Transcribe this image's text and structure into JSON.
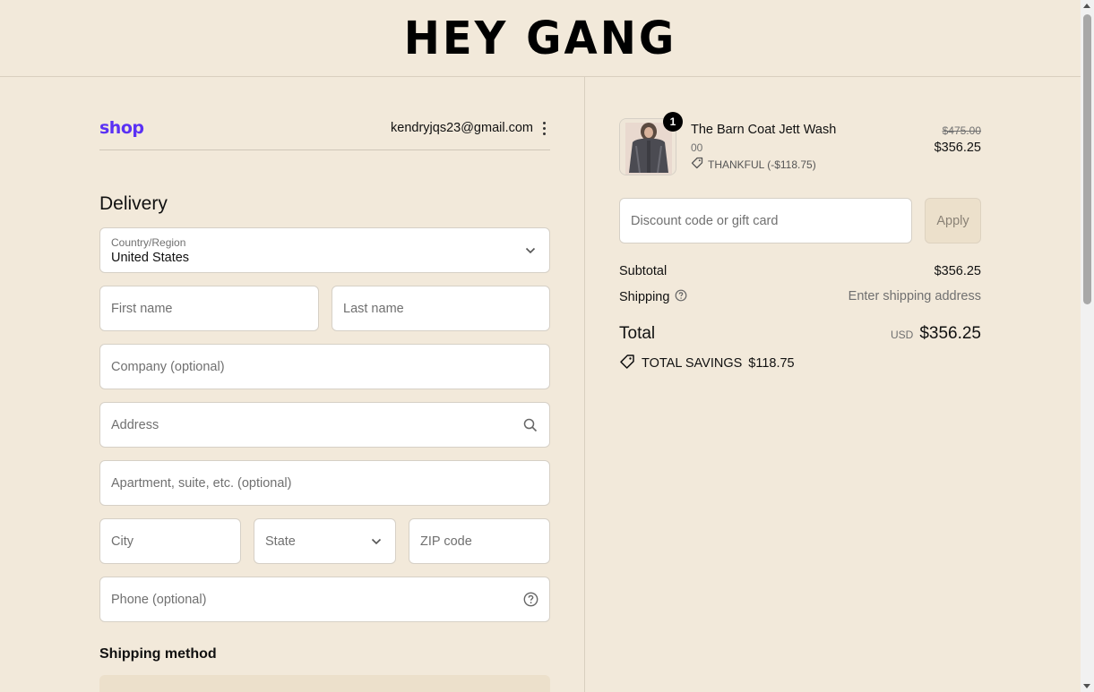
{
  "brand": {
    "logo_text": "HEY GANG"
  },
  "account": {
    "shop_logo": "shop",
    "email": "kendryjqs23@gmail.com",
    "menu_icon": "kebab-menu-icon"
  },
  "delivery": {
    "heading": "Delivery",
    "country": {
      "label": "Country/Region",
      "value": "United States"
    },
    "first_name": {
      "placeholder": "First name"
    },
    "last_name": {
      "placeholder": "Last name"
    },
    "company": {
      "placeholder": "Company (optional)"
    },
    "address": {
      "placeholder": "Address"
    },
    "apartment": {
      "placeholder": "Apartment, suite, etc. (optional)"
    },
    "city": {
      "placeholder": "City"
    },
    "state": {
      "placeholder": "State"
    },
    "zip": {
      "placeholder": "ZIP code"
    },
    "phone": {
      "placeholder": "Phone (optional)"
    }
  },
  "shipping_method": {
    "heading": "Shipping method"
  },
  "summary": {
    "item": {
      "quantity": "1",
      "name": "The Barn Coat Jett Wash",
      "variant": "00",
      "discount": "THANKFUL (-$118.75)",
      "original_price": "$475.00",
      "price": "$356.25"
    },
    "discount_field": {
      "placeholder": "Discount code or gift card"
    },
    "apply_label": "Apply",
    "subtotal_label": "Subtotal",
    "subtotal_value": "$356.25",
    "shipping_label": "Shipping",
    "shipping_value": "Enter shipping address",
    "total_label": "Total",
    "currency": "USD",
    "total_value": "$356.25",
    "savings_label": "TOTAL SAVINGS",
    "savings_value": "$118.75"
  },
  "colors": {
    "background": "#f2e9da",
    "shop_brand": "#5a31f4",
    "button_disabled": "#ece0cb"
  }
}
